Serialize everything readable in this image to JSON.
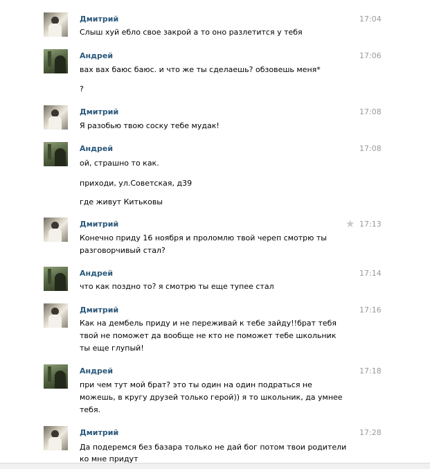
{
  "messages": [
    {
      "author": "Дмитрий",
      "time": "17:04",
      "lines": [
        "Слыш хуй ебло свое закрой а то оно разлетится у тебя"
      ]
    },
    {
      "author": "Андрей",
      "time": "17:06",
      "lines": [
        "вах вах баюс баюс. и что же ты сделаешь? обзовешь меня*",
        "?"
      ]
    },
    {
      "author": "Дмитрий",
      "time": "17:08",
      "lines": [
        "Я разобью твою соску тебе мудак!"
      ]
    },
    {
      "author": "Андрей",
      "time": "17:08",
      "lines": [
        "ой, страшно то как.",
        "приходи, ул.Советская, д39",
        "где живут Китьковы"
      ]
    },
    {
      "author": "Дмитрий",
      "time": "17:13",
      "lines": [
        "Конечно приду 16 ноября и проломлю твой череп смотрю ты",
        "разговорчивый стал?"
      ]
    },
    {
      "author": "Андрей",
      "time": "17:14",
      "lines": [
        "что как поздно то? я смотрю ты еще тупее стал"
      ]
    },
    {
      "author": "Дмитрий",
      "time": "17:16",
      "lines": [
        "Как на дембель приду и не переживай к тебе зайду!!брат тебя",
        "твой не поможет да вообще не кто не поможет тебе школьник",
        "ты еще глупый!"
      ]
    },
    {
      "author": "Андрей",
      "time": "17:18",
      "lines": [
        "при чем тут мой брат? это ты один на один подраться не",
        "можешь, в кругу друзей только герой)) я то школьник, да умнее",
        "тебя."
      ]
    },
    {
      "author": "Дмитрий",
      "time": "17:28",
      "lines": [
        "Да подеремся без базара только не дай бог потом твои родители",
        "ко мне придут"
      ]
    }
  ]
}
